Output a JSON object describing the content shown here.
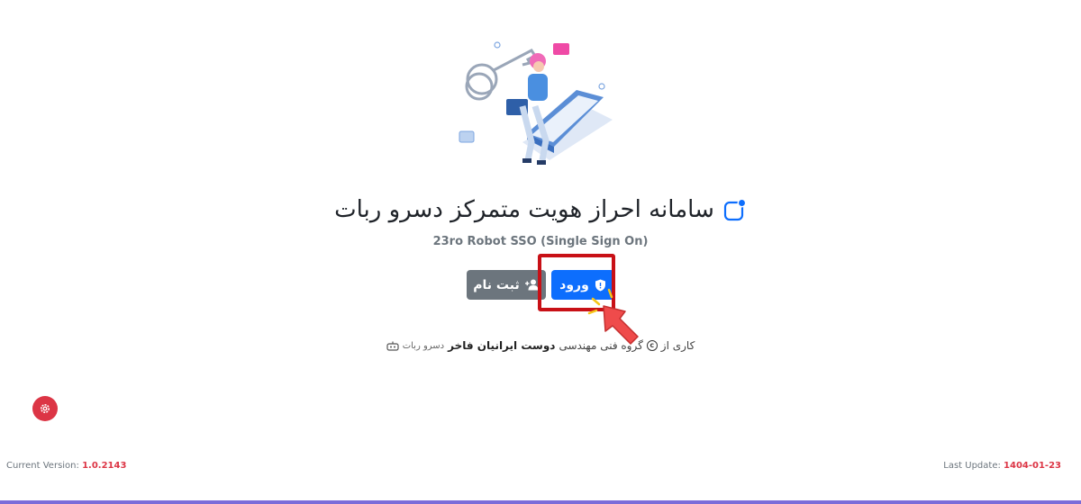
{
  "header": {
    "title": "سامانه احراز هویت متمرکز دسرو ربات",
    "subtitle": "23ro Robot SSO (Single Sign On)"
  },
  "actions": {
    "login_label": "ورود",
    "register_label": "ثبت نام"
  },
  "credit": {
    "prefix": "کاری از",
    "group": "گروه فنی مهندسی",
    "company": "دوست ایرانیان فاخر",
    "brand": "دسرو ربات"
  },
  "footer": {
    "version_label": "Current Version:",
    "version_value": "1.0.2143",
    "update_label": "Last Update:",
    "update_value": "1404-01-23"
  },
  "colors": {
    "primary": "#0d6efd",
    "secondary": "#6c757d",
    "danger": "#dc3545",
    "highlight": "#c81016"
  },
  "icons": {
    "login": "shield-icon",
    "register": "user-plus-icon",
    "settings": "gear-icon",
    "copyright": "copyright-icon",
    "robot": "robot-icon"
  }
}
